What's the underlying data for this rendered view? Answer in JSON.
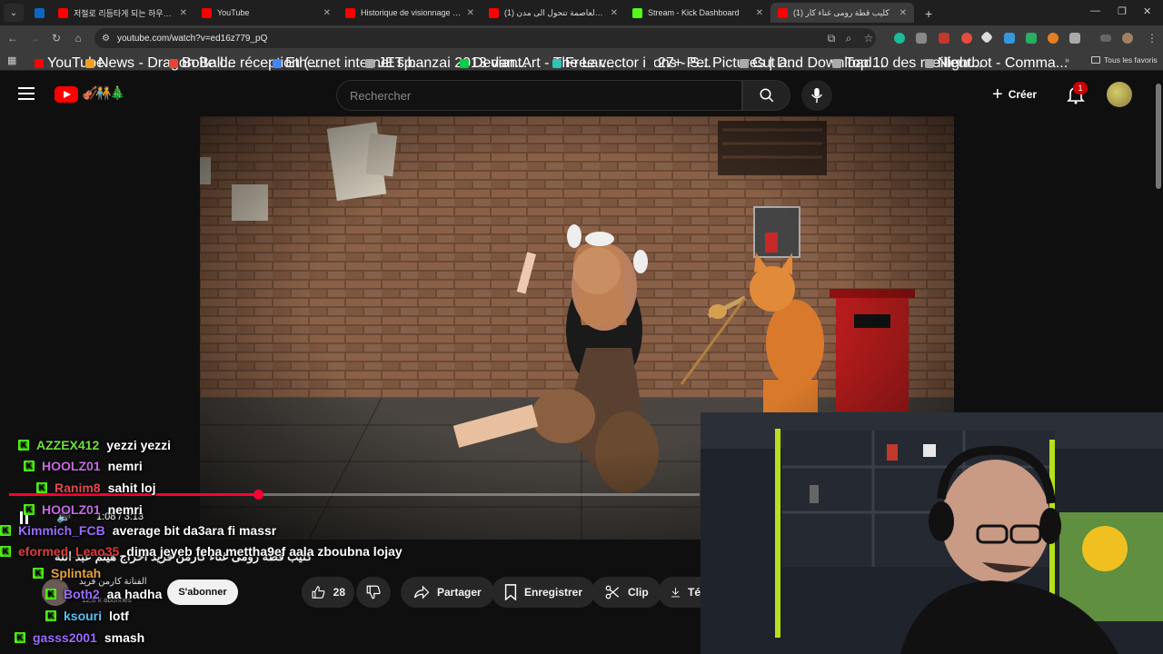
{
  "browser": {
    "tabs": [
      {
        "title": "",
        "favicon_color": "#0a66c2"
      },
      {
        "title": "저절로 리듬타게 되는 하우스 -",
        "favicon_color": "#ff0000"
      },
      {
        "title": "YouTube",
        "favicon_color": "#ff0000"
      },
      {
        "title": "Historique de visionnage - YouT",
        "favicon_color": "#ff0000"
      },
      {
        "title": "(1) تونس العاصمة تتحول الى مدن",
        "favicon_color": "#ff0000"
      },
      {
        "title": "Stream - Kick Dashboard",
        "favicon_color": "#53fc18"
      },
      {
        "title": "(1) كليب قطة رومى غناء كار",
        "favicon_color": "#ff0000"
      }
    ],
    "url": "youtube.com/watch?v=ed16z779_pQ",
    "bookmarks": [
      {
        "label": "YouTube",
        "color": "#ff0000"
      },
      {
        "label": "News - Dragon Ball...",
        "color": "#f0a020"
      },
      {
        "label": "Boîte de réception (...",
        "color": "#ea4335"
      },
      {
        "label": "Ethernet internet sp...",
        "color": "#4285f4"
      },
      {
        "label": "JET banzai 2013 dan...",
        "color": "#aaaaaa"
      },
      {
        "label": "DeviantArt - The Lar...",
        "color": "#05cc47"
      },
      {
        "label": "Free vector icons - S...",
        "color": "#2ec4b6"
      },
      {
        "label": "27+ Pet Pictures | D...",
        "color": "#333333"
      },
      {
        "label": "Cut and Download...",
        "color": "#aaaaaa"
      },
      {
        "label": "Top 10 des meilleur...",
        "color": "#aaaaaa"
      },
      {
        "label": "Nightbot - Comma...",
        "color": "#aaaaaa"
      }
    ],
    "all_bookmarks": "Tous les favoris"
  },
  "youtube": {
    "search_placeholder": "Rechercher",
    "create_label": "Créer",
    "notification_count": "1",
    "video_time": "1:08 / 3:13",
    "progress_fraction": 0.36,
    "video_title": "كليب قطة رومى غناء كارمن فريد اخراج هيثم عبد الله",
    "channel_name": "الفنانة كارمن فريد",
    "channel_subs": "12,8 k abonnés",
    "subscribe_label": "S'abonner",
    "like_count": "28",
    "share_label": "Partager",
    "save_label": "Enregistrer",
    "clip_label": "Clip",
    "download_label": "Té"
  },
  "chat": [
    {
      "user": "AZZEX412",
      "message": "yezzi yezzi",
      "color": "#6fe03a"
    },
    {
      "user": "HOOLZ01",
      "message": "nemri",
      "color": "#c46be0"
    },
    {
      "user": "Ranim8",
      "message": "sahit loj",
      "color": "#e04b4b"
    },
    {
      "user": "HOOLZ01",
      "message": "nemri",
      "color": "#c46be0"
    },
    {
      "user": "Kimmich_FCB",
      "message": "average bit da3ara fi massr",
      "color": "#9b6bff"
    },
    {
      "user": "eformed_Leao35",
      "message": "dima jeyeb feha mettha9ef aala zboubna lojay",
      "color": "#e03a3a"
    },
    {
      "user": "Splintah",
      "message": "",
      "color": "#e8a43a"
    },
    {
      "user": "Both2",
      "message": "aa hadha",
      "color": "#9b6bff"
    },
    {
      "user": "ksouri",
      "message": "lotf",
      "color": "#4fc3f7"
    },
    {
      "user": "gasss2001",
      "message": "smash",
      "color": "#9b6bff"
    }
  ]
}
